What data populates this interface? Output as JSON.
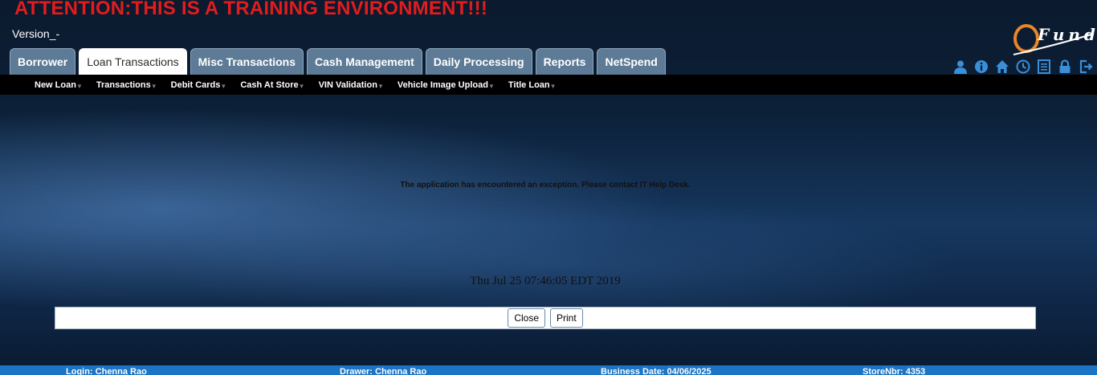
{
  "header": {
    "attention": "ATTENTION:THIS IS A TRAINING ENVIRONMENT!!!",
    "version": "Version_-",
    "logo_text": "Fund"
  },
  "tabs": [
    {
      "label": "Borrower",
      "active": false
    },
    {
      "label": "Loan Transactions",
      "active": true
    },
    {
      "label": "Misc Transactions",
      "active": false
    },
    {
      "label": "Cash Management",
      "active": false
    },
    {
      "label": "Daily Processing",
      "active": false
    },
    {
      "label": "Reports",
      "active": false
    },
    {
      "label": "NetSpend",
      "active": false
    }
  ],
  "top_icons": [
    "user-icon",
    "info-icon",
    "home-icon",
    "clock-icon",
    "list-icon",
    "lock-icon",
    "logout-icon"
  ],
  "subnav": [
    {
      "label": "New Loan"
    },
    {
      "label": "Transactions"
    },
    {
      "label": "Debit Cards"
    },
    {
      "label": "Cash At Store"
    },
    {
      "label": "VIN Validation"
    },
    {
      "label": "Vehicle Image Upload"
    },
    {
      "label": "Title Loan"
    }
  ],
  "main": {
    "error_message": "The application has encountered an exception. Please contact IT Help Desk.",
    "timestamp": "Thu Jul 25 07:46:05 EDT 2019",
    "close_label": "Close",
    "print_label": "Print"
  },
  "footer": {
    "login": "Login: Chenna Rao",
    "drawer": "Drawer: Chenna Rao",
    "business_date": "Business Date: 04/06/2025",
    "store": "StoreNbr: 4353"
  },
  "colors": {
    "attention": "#e31c1c",
    "tab": "#5d7b96",
    "tab_active": "#ffffff",
    "subnav": "#000000",
    "footer": "#1b74c4",
    "icon": "#3a8fd8",
    "logo_ring": "#e8862a"
  }
}
